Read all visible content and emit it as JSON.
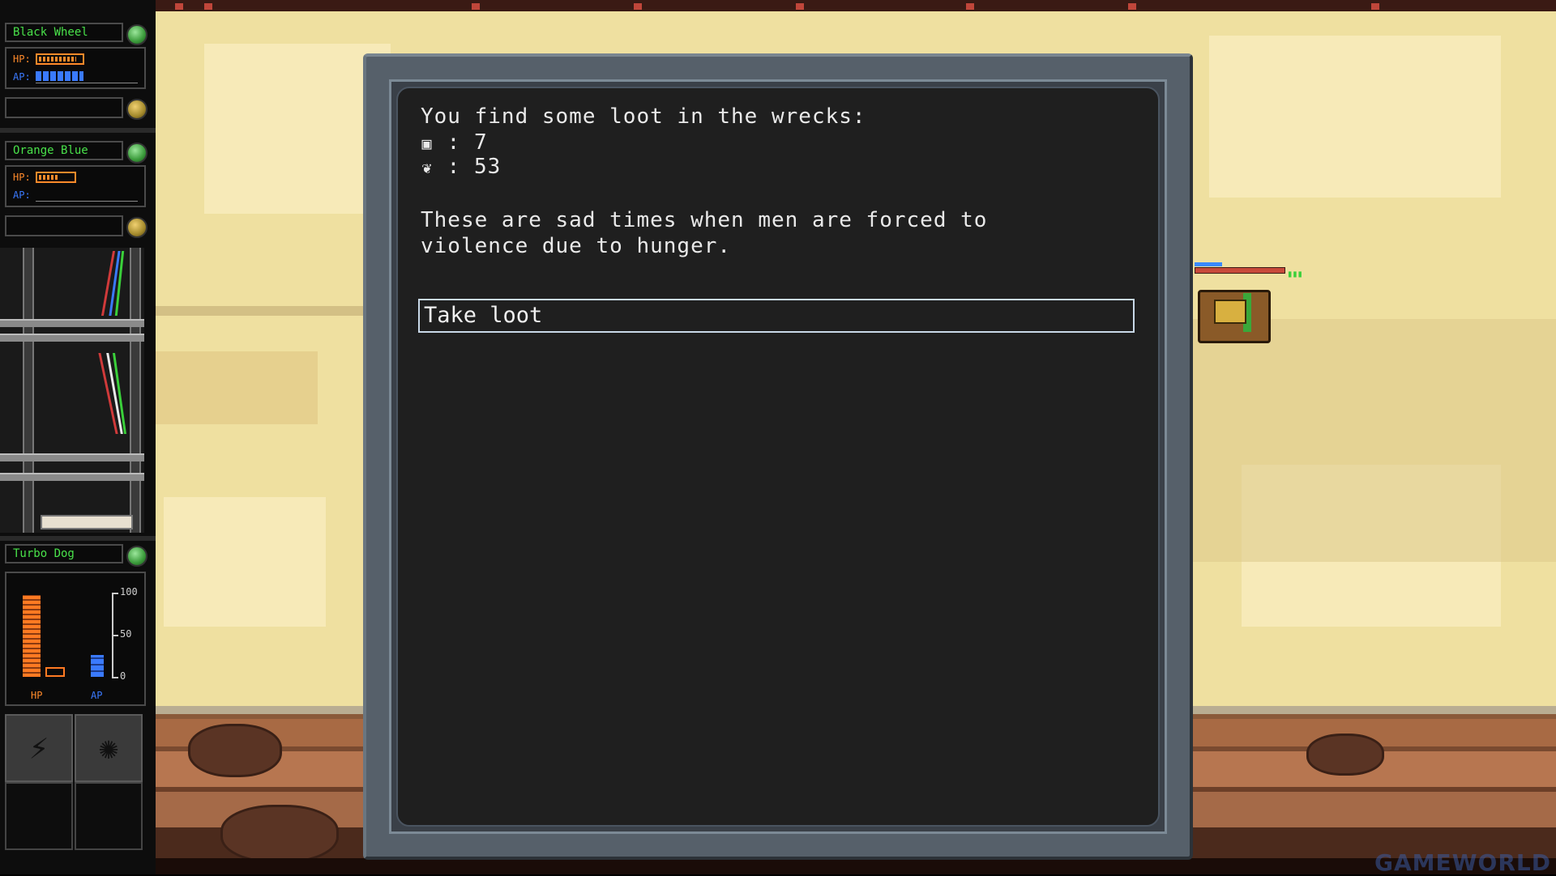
{
  "units": [
    {
      "name": "Black Wheel",
      "hp_label": "HP:",
      "ap_label": "AP:",
      "hp_fraction": 0.9,
      "ap_fraction": 0.5
    },
    {
      "name": "Orange Blue",
      "hp_label": "HP:",
      "ap_label": "AP:",
      "hp_fraction": 0.6,
      "ap_fraction": 0.0
    }
  ],
  "selected_unit": {
    "name": "Turbo Dog",
    "hp_label": "HP",
    "ap_label": "AP",
    "scale_ticks": [
      "100",
      "50",
      "0"
    ],
    "hp_fraction": 0.95,
    "ap_fraction": 0.25
  },
  "dialog": {
    "intro": "You find some loot in the wrecks:",
    "loot": [
      {
        "icon": "scrap-icon",
        "glyph": "▣",
        "text": ": 7"
      },
      {
        "icon": "fuel-icon",
        "glyph": "❦",
        "text": ": 53"
      }
    ],
    "message_line1": "These are sad times when men are forced to",
    "message_line2": "violence due to hunger.",
    "option": "Take loot"
  },
  "watermark": "GAMEWORLD",
  "colors": {
    "hp": "#ff8a2a",
    "ap": "#3a7aff",
    "name_text": "#49e24a",
    "dialog_bg": "#1f1f1f",
    "sand": "#efe0a0"
  }
}
